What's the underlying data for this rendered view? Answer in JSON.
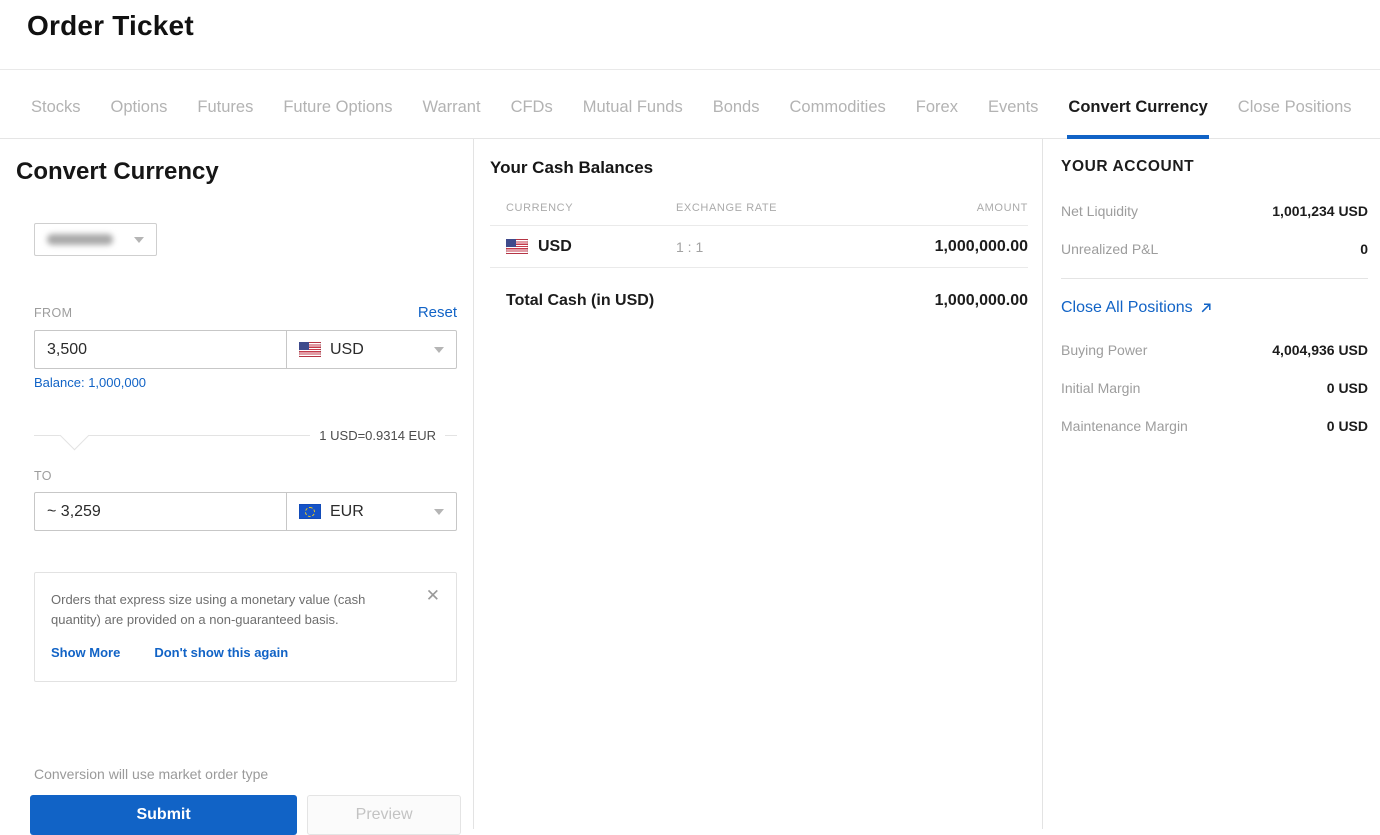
{
  "page": {
    "title": "Order Ticket"
  },
  "tabs": {
    "items": [
      {
        "label": "Stocks"
      },
      {
        "label": "Options"
      },
      {
        "label": "Futures"
      },
      {
        "label": "Future Options"
      },
      {
        "label": "Warrant"
      },
      {
        "label": "CFDs"
      },
      {
        "label": "Mutual Funds"
      },
      {
        "label": "Bonds"
      },
      {
        "label": "Commodities"
      },
      {
        "label": "Forex"
      },
      {
        "label": "Events"
      },
      {
        "label": "Convert Currency"
      },
      {
        "label": "Close Positions"
      }
    ],
    "active": "Convert Currency"
  },
  "convert": {
    "heading": "Convert Currency",
    "from": {
      "label": "FROM",
      "reset_label": "Reset",
      "amount": "3,500",
      "currency": "USD",
      "balance_text": "Balance: 1,000,000"
    },
    "rate_text": "1 USD=0.9314 EUR",
    "to": {
      "label": "TO",
      "amount": "~ 3,259",
      "currency": "EUR"
    },
    "notice": {
      "text": "Orders that express size using a monetary value (cash quantity) are provided on a non-guaranteed basis.",
      "show_more_label": "Show More",
      "dont_show_label": "Don't show this again",
      "close_icon": "✕"
    },
    "footnote": "Conversion will use market order type",
    "submit_label": "Submit",
    "preview_label": "Preview"
  },
  "balances": {
    "heading": "Your Cash Balances",
    "columns": {
      "currency": "CURRENCY",
      "rate": "EXCHANGE RATE",
      "amount": "AMOUNT"
    },
    "rows": [
      {
        "currency": "USD",
        "rate": "1 : 1",
        "amount": "1,000,000.00"
      }
    ],
    "total_label": "Total Cash (in USD)",
    "total_amount": "1,000,000.00"
  },
  "account": {
    "heading": "YOUR ACCOUNT",
    "net_liquidity": {
      "label": "Net Liquidity",
      "value": "1,001,234 USD"
    },
    "unrealized_pl": {
      "label": "Unrealized P&L",
      "value": "0"
    },
    "close_all_label": "Close All Positions",
    "buying_power": {
      "label": "Buying Power",
      "value": "4,004,936 USD"
    },
    "initial_margin": {
      "label": "Initial Margin",
      "value": "0 USD"
    },
    "maintenance_margin": {
      "label": "Maintenance Margin",
      "value": "0 USD"
    }
  },
  "colors": {
    "accent": "#1163c6",
    "tab_inactive": "#b3b3b3",
    "divider": "#e3e3e3"
  }
}
